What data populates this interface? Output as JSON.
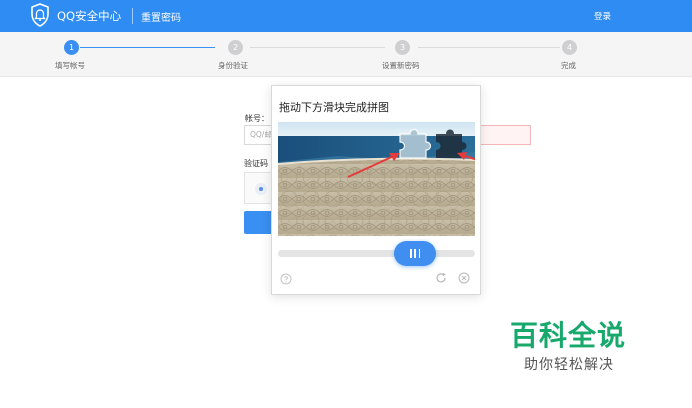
{
  "header": {
    "brand": "QQ安全中心",
    "section_title": "重置密码",
    "login_label": "登录",
    "background_color": "#2f8cf3",
    "logo_icon": "shield-bell-icon"
  },
  "steps": [
    {
      "number": "1",
      "label": "填写帐号",
      "active": true
    },
    {
      "number": "2",
      "label": "身份验证",
      "active": false
    },
    {
      "number": "3",
      "label": "设置新密码",
      "active": false
    },
    {
      "number": "4",
      "label": "完成",
      "active": false
    }
  ],
  "form": {
    "account_label": "帐号：",
    "account_placeholder": "QQ/邮",
    "captcha_label": "验证码"
  },
  "captcha_modal": {
    "title": "拖动下方滑块完成拼图",
    "help_icon": "question-circle-icon",
    "refresh_icon": "refresh-icon",
    "close_icon": "close-circle-icon",
    "slider_progress": 0.65
  },
  "watermark": {
    "main": "百科全说",
    "sub": "助你轻松解决"
  },
  "colors": {
    "accent": "#3a8ff2",
    "watermark_green": "#17a86b",
    "annotation_arrow": "#e63b3b"
  }
}
